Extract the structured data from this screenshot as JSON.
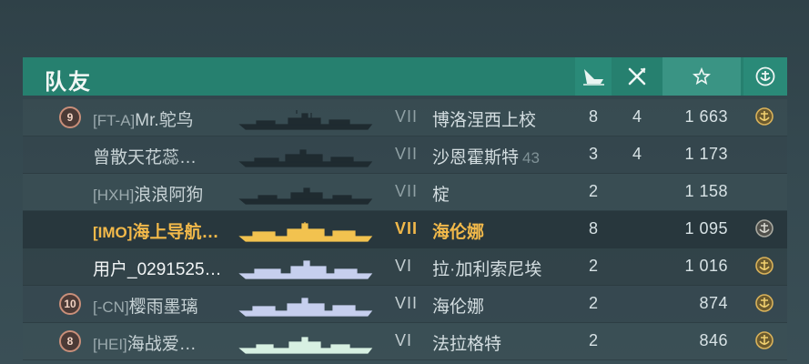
{
  "panel": {
    "title": "队友",
    "columns": {
      "ship_icon": "ship-icon",
      "frag_icon": "crossed-swords-icon",
      "xp_icon": "star-icon",
      "rank_icon": "anchor-emblem-icon"
    }
  },
  "players": [
    {
      "level": "9",
      "tag": "[FT-A]",
      "name": "Mr.鸵鸟",
      "tier": "VII",
      "ship": "博洛涅西上校",
      "ship_extra": "",
      "kills": "8",
      "frags": "4",
      "xp": "1 663",
      "medal": true,
      "silhouette_color": "#1f2b30"
    },
    {
      "level": "",
      "tag": "",
      "name": "曾散天花蕊…",
      "tier": "VII",
      "ship": "沙恩霍斯特",
      "ship_extra": "43",
      "kills": "3",
      "frags": "4",
      "xp": "1 173",
      "medal": false,
      "silhouette_color": "#1f2b30"
    },
    {
      "level": "",
      "tag": "[HXH]",
      "name": "浪浪阿狗",
      "tier": "VII",
      "ship": "椗",
      "ship_extra": "",
      "kills": "2",
      "frags": "",
      "xp": "1 158",
      "medal": false,
      "silhouette_color": "#1f2b30"
    },
    {
      "level": "",
      "tag": "[IMO]",
      "name": "海上导航…",
      "tier": "VII",
      "ship": "海伦娜",
      "ship_extra": "",
      "kills": "8",
      "frags": "",
      "xp": "1 095",
      "medal": true,
      "silhouette_color": "#f2c24f"
    },
    {
      "level": "",
      "tag": "",
      "name": "用户_0291525…",
      "tier": "VI",
      "ship": "拉·加利索尼埃",
      "ship_extra": "",
      "kills": "2",
      "frags": "",
      "xp": "1 016",
      "medal": true,
      "silhouette_color": "#c6cfee"
    },
    {
      "level": "10",
      "tag": "[-CN]",
      "name": "樱雨墨璃",
      "tier": "VII",
      "ship": "海伦娜",
      "ship_extra": "",
      "kills": "2",
      "frags": "",
      "xp": "874",
      "medal": true,
      "silhouette_color": "#c6cfee"
    },
    {
      "level": "8",
      "tag": "[HEI]",
      "name": "海战爱…",
      "tier": "VI",
      "ship": "法拉格特",
      "ship_extra": "",
      "kills": "2",
      "frags": "",
      "xp": "846",
      "medal": true,
      "silhouette_color": "#d7f0e2"
    }
  ]
}
